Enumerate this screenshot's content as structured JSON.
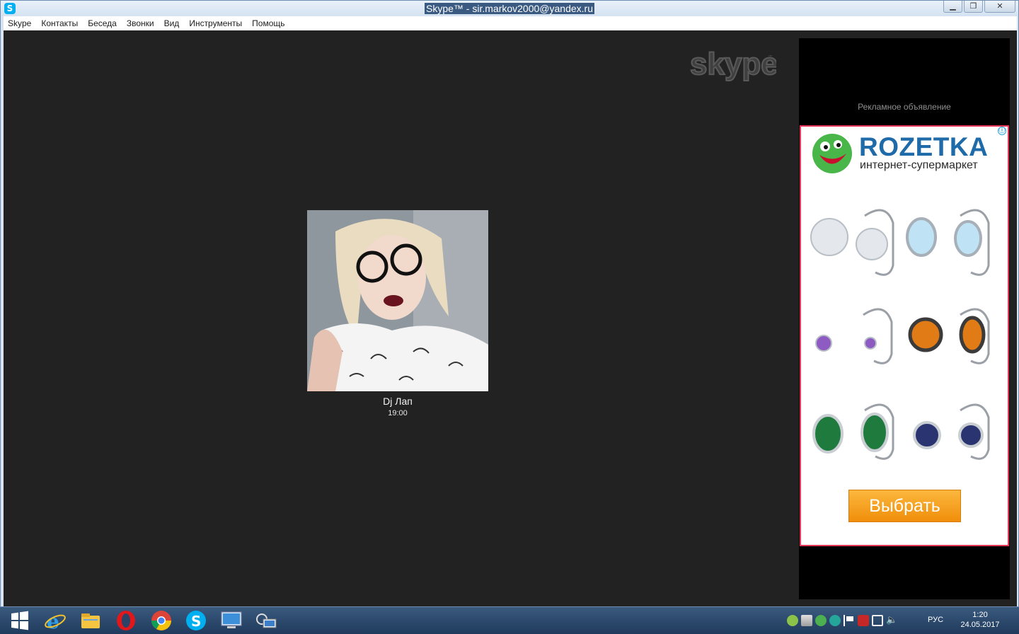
{
  "window": {
    "title": "Skype™ - sir.markov2000@yandex.ru",
    "app_icon_letter": "S"
  },
  "menu": [
    "Skype",
    "Контакты",
    "Беседа",
    "Звонки",
    "Вид",
    "Инструменты",
    "Помощь"
  ],
  "watermark": {
    "text": "skype"
  },
  "contact": {
    "name": "Dj Лап",
    "time": "19:00"
  },
  "ad": {
    "label": "Рекламное объявление",
    "info_icon": "ⓘ",
    "brand": "ROZETKA",
    "tagline": "интернет-супермаркет",
    "cta": "Выбрать",
    "colors": {
      "brand": "#1f6aa8",
      "border": "#e8365b",
      "cta": "#f5a21f",
      "smiley": "#48b649"
    }
  },
  "taskbar": {
    "language": "РУС",
    "time": "1:20",
    "date": "24.05.2017",
    "pinned_icons": [
      "windows-start-icon",
      "internet-explorer-icon",
      "file-explorer-icon",
      "opera-icon",
      "chrome-icon",
      "skype-icon",
      "computer-icon",
      "camera-recorder-icon"
    ]
  }
}
